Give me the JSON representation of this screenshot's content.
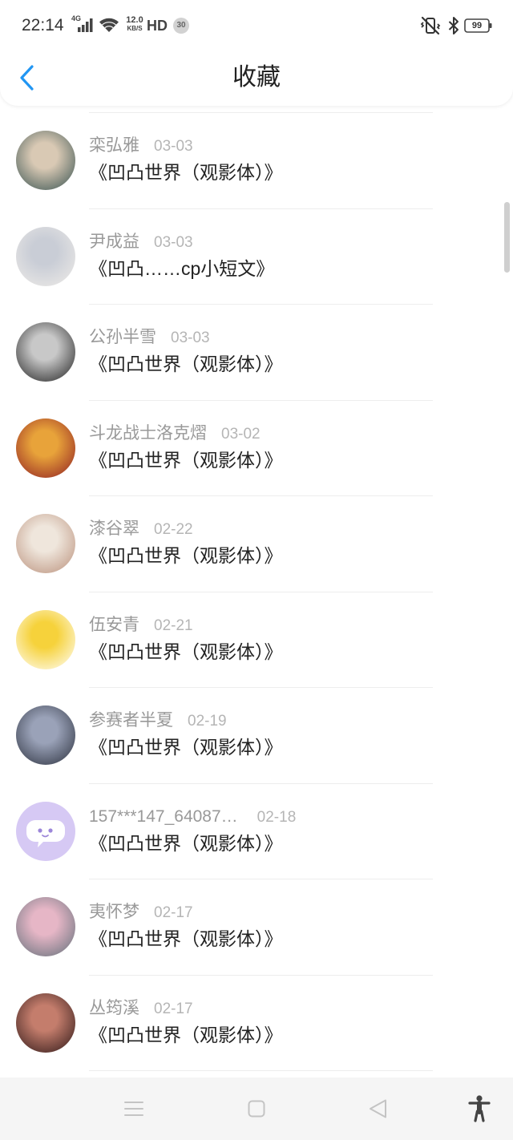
{
  "status_bar": {
    "time": "22:14",
    "network": "4G",
    "speed_value": "12.0",
    "speed_unit": "KB/S",
    "hd": "HD",
    "notification_count": "30",
    "battery": "99",
    "icons": [
      "signal-icon",
      "wifi-icon",
      "vibrate-off-icon",
      "bluetooth-icon",
      "battery-icon"
    ]
  },
  "header": {
    "title": "收藏",
    "back_icon": "chevron-left-icon"
  },
  "colors": {
    "accent": "#2196F3",
    "author_name": "#999999",
    "date": "#B5B5B5",
    "work_title": "#222222",
    "divider": "#EDEDED"
  },
  "favorites": [
    {
      "name": "栾弘雅",
      "date": "03-03",
      "title": "《凹凸世界（观影体）》",
      "avatar_colors": [
        "#D9C9B4",
        "#35504F"
      ]
    },
    {
      "name": "尹成益",
      "date": "03-03",
      "title": "《凹凸……cp小短文》",
      "avatar_colors": [
        "#C9CDD6",
        "#EFECE8"
      ]
    },
    {
      "name": "公孙半雪",
      "date": "03-03",
      "title": "《凹凸世界（观影体）》",
      "avatar_colors": [
        "#C8C8C8",
        "#1E1E1E"
      ]
    },
    {
      "name": "斗龙战士洛克熠",
      "date": "03-02",
      "title": "《凹凸世界（观影体）》",
      "avatar_colors": [
        "#E8A33A",
        "#8E1C22"
      ]
    },
    {
      "name": "漆谷翠",
      "date": "02-22",
      "title": "《凹凸世界（观影体）》",
      "avatar_colors": [
        "#EFE6DC",
        "#B98F7A"
      ]
    },
    {
      "name": "伍安青",
      "date": "02-21",
      "title": "《凹凸世界（观影体）》",
      "avatar_colors": [
        "#F6D23B",
        "#FFFFFF"
      ]
    },
    {
      "name": "参赛者半夏",
      "date": "02-19",
      "title": "《凹凸世界（观影体）》",
      "avatar_colors": [
        "#9AA2B8",
        "#2A2F3C"
      ]
    },
    {
      "name": "157***147_64087…",
      "date": "02-18",
      "title": "《凹凸世界（观影体）》",
      "avatar_colors": [
        "#D6C9F4",
        "#D6C9F4"
      ],
      "avatar_icon": "chat-bubble-icon"
    },
    {
      "name": "夷怀梦",
      "date": "02-17",
      "title": "《凹凸世界（观影体）》",
      "avatar_colors": [
        "#E6B6C6",
        "#5F6E78"
      ]
    },
    {
      "name": "丛筠溪",
      "date": "02-17",
      "title": "《凹凸世界（观影体）》",
      "avatar_colors": [
        "#C47D6C",
        "#2B1616"
      ]
    }
  ],
  "nav_bar": {
    "icons": [
      "menu-icon",
      "home-square-icon",
      "back-triangle-icon",
      "accessibility-icon"
    ]
  }
}
